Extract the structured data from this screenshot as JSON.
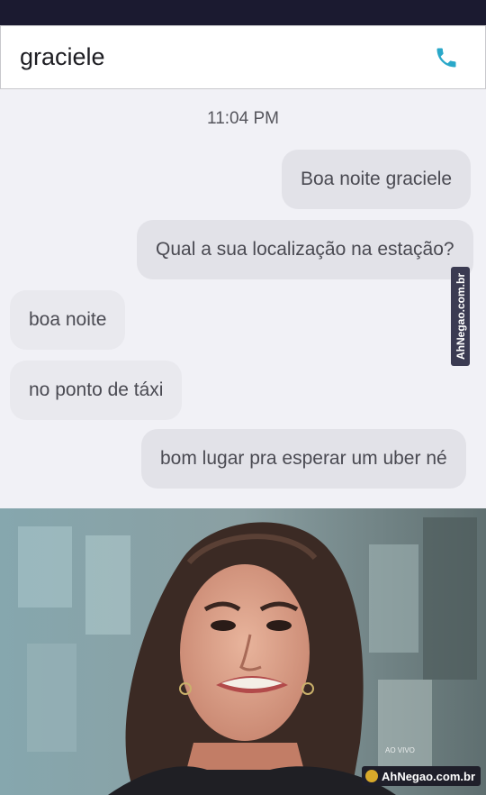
{
  "header": {
    "contact_name": "graciele",
    "call_icon": "phone-icon",
    "accent_color": "#2aa8c9"
  },
  "chat": {
    "timestamp": "11:04 PM",
    "messages": [
      {
        "side": "sent",
        "text": "Boa noite graciele"
      },
      {
        "side": "sent",
        "text": "Qual a sua localização na estação?"
      },
      {
        "side": "received",
        "text": "boa noite"
      },
      {
        "side": "received",
        "text": "no ponto de táxi"
      },
      {
        "side": "sent",
        "text": "bom lugar pra esperar um uber né"
      }
    ]
  },
  "watermarks": {
    "side": "AhNegao.com.br",
    "bottom": "AhNegao.com.br",
    "tv_badge": "AO VIVO"
  },
  "photo": {
    "subject": "reaction-photo"
  }
}
